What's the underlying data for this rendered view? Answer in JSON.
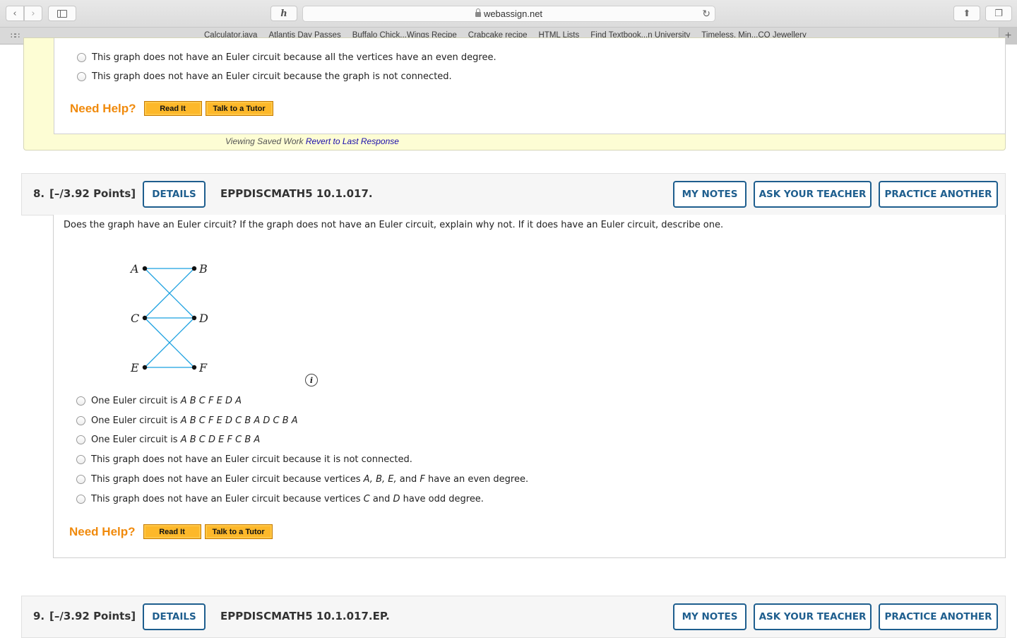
{
  "browser": {
    "url": "webassign.net",
    "bookmarks": [
      "Calculator.java",
      "Atlantis Day Passes",
      "Buffalo Chick...Wings Recipe",
      "Crabcake recipe",
      "HTML Lists",
      "Find Textbook...n University",
      "Timeless. Min...CO Jewellery"
    ]
  },
  "q7": {
    "options": [
      "This graph does not have an Euler circuit because all the vertices have an even degree.",
      "This graph does not have an Euler circuit because the graph is not connected."
    ],
    "help_label": "Need Help?",
    "read_it": "Read It",
    "talk_tutor": "Talk to a Tutor",
    "saved_text": "Viewing Saved Work",
    "revert_link": "Revert to Last Response"
  },
  "q8": {
    "number": "8.",
    "points": "[–/3.92 Points]",
    "details": "DETAILS",
    "code": "EPPDISCMATH5 10.1.017.",
    "my_notes": "MY NOTES",
    "ask_teacher": "ASK YOUR TEACHER",
    "practice_another": "PRACTICE ANOTHER",
    "prompt": "Does the graph have an Euler circuit? If the graph does not have an Euler circuit, explain why not. If it does have an Euler circuit, describe one.",
    "graph": {
      "vertices": [
        {
          "label": "A",
          "side": "left",
          "row": 0
        },
        {
          "label": "B",
          "side": "right",
          "row": 0
        },
        {
          "label": "C",
          "side": "left",
          "row": 1
        },
        {
          "label": "D",
          "side": "right",
          "row": 1
        },
        {
          "label": "E",
          "side": "left",
          "row": 2
        },
        {
          "label": "F",
          "side": "right",
          "row": 2
        }
      ],
      "edges": [
        [
          "A",
          "B"
        ],
        [
          "A",
          "D"
        ],
        [
          "B",
          "C"
        ],
        [
          "C",
          "D"
        ],
        [
          "C",
          "F"
        ],
        [
          "D",
          "E"
        ],
        [
          "E",
          "F"
        ]
      ],
      "edge_color": "#1aa0e0"
    },
    "options": [
      {
        "prefix": "One Euler circuit is ",
        "italic": "A B C F E D A",
        "suffix": ""
      },
      {
        "prefix": "One Euler circuit is ",
        "italic": "A B C F E D C B A D C B A",
        "suffix": ""
      },
      {
        "prefix": "One Euler circuit is ",
        "italic": "A B C D E F C B A",
        "suffix": ""
      },
      {
        "prefix": "This graph does not have an Euler circuit because it is not connected.",
        "italic": "",
        "suffix": ""
      },
      {
        "prefix": "This graph does not have an Euler circuit because vertices ",
        "italic": "A, B, E,",
        "suffix": " and F have an even degree."
      },
      {
        "prefix": "This graph does not have an Euler circuit because vertices ",
        "italic": "C",
        "suffix": " and D have odd degree."
      }
    ],
    "help_label": "Need Help?",
    "read_it": "Read It",
    "talk_tutor": "Talk to a Tutor"
  },
  "q9": {
    "number": "9.",
    "points": "[–/3.92 Points]",
    "details": "DETAILS",
    "code": "EPPDISCMATH5 10.1.017.EP.",
    "my_notes": "MY NOTES",
    "ask_teacher": "ASK YOUR TEACHER",
    "practice_another": "PRACTICE ANOTHER"
  }
}
